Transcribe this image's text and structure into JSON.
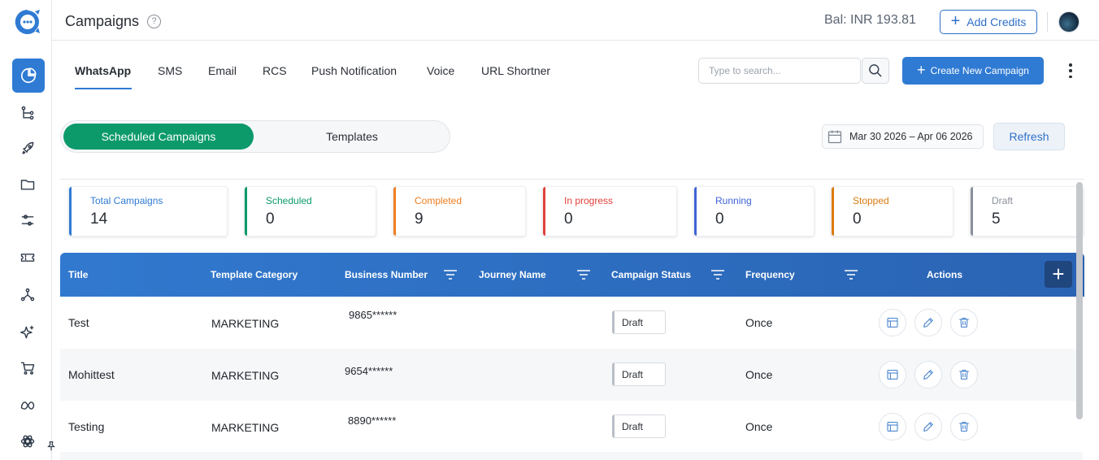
{
  "header": {
    "title": "Campaigns",
    "help_glyph": "?",
    "balance": "Bal: INR 193.81",
    "add_credits_label": "Add Credits"
  },
  "sidebar": {
    "items": [
      "dashboard-icon",
      "flow-icon",
      "rocket-icon",
      "folder-icon",
      "sliders-icon",
      "ticket-icon",
      "network-icon",
      "sparkle-icon",
      "cart-icon",
      "meta-icon",
      "ai-icon"
    ],
    "active": "dashboard-icon"
  },
  "tabs": [
    {
      "label": "WhatsApp",
      "active": true
    },
    {
      "label": "SMS"
    },
    {
      "label": "Email"
    },
    {
      "label": "RCS"
    },
    {
      "label": "Push Notification"
    },
    {
      "label": "Voice"
    },
    {
      "label": "URL Shortner"
    }
  ],
  "search": {
    "placeholder": "Type to search..."
  },
  "create_button": "Create New Campaign",
  "toggle": {
    "active": "Scheduled Campaigns",
    "inactive": "Templates"
  },
  "date_range": "Mar 30 2026 – Apr 06 2026",
  "refresh_label": "Refresh",
  "stats": [
    {
      "label": "Total Campaigns",
      "value": "14",
      "color": "#2f7bd3"
    },
    {
      "label": "Scheduled",
      "value": "0",
      "color": "#0c9a6b"
    },
    {
      "label": "Completed",
      "value": "9",
      "color": "#f07c1e"
    },
    {
      "label": "In progress",
      "value": "0",
      "color": "#e0403a"
    },
    {
      "label": "Running",
      "value": "0",
      "color": "#3f63d6"
    },
    {
      "label": "Stopped",
      "value": "0",
      "color": "#d97a12"
    },
    {
      "label": "Draft",
      "value": "5",
      "color": "#8a9099"
    }
  ],
  "table": {
    "columns": [
      "Title",
      "Template Category",
      "Business Number",
      "Journey Name",
      "Campaign Status",
      "Frequency",
      "Actions"
    ],
    "rows": [
      {
        "title": "Test",
        "category": "MARKETING",
        "number": "9865******",
        "journey": "",
        "status": "Draft",
        "frequency": "Once"
      },
      {
        "title": "Mohittest",
        "category": "MARKETING",
        "number": "9654******",
        "journey": "",
        "status": "Draft",
        "frequency": "Once"
      },
      {
        "title": "Testing",
        "category": "MARKETING",
        "number": "8890******",
        "journey": "",
        "status": "Draft",
        "frequency": "Once"
      }
    ]
  },
  "colors": {
    "primary": "#2f7bd3",
    "green": "#0c9a6b"
  }
}
